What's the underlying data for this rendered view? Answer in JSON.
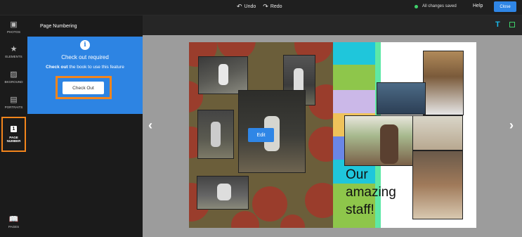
{
  "topbar": {
    "undo_label": "Undo",
    "redo_label": "Redo",
    "saved_status": "All changes saved",
    "help_label": "Help",
    "close_label": "Close"
  },
  "leftnav": {
    "items": [
      {
        "label": "PHOTOS",
        "icon": "photos-icon"
      },
      {
        "label": "ELEMENTS",
        "icon": "star-icon"
      },
      {
        "label": "BKGROUND",
        "icon": "background-icon"
      },
      {
        "label": "PORTRAITS",
        "icon": "portraits-icon"
      }
    ],
    "active": {
      "number": "1",
      "label_line1": "PAGE",
      "label_line2": "NUMBER"
    },
    "pages_label": "PAGES"
  },
  "panel": {
    "title": "Page Numbering",
    "card_title": "Check out required",
    "card_msg_bold": "Check out",
    "card_msg_rest": " the book to use this feature",
    "checkout_label": "Check Out"
  },
  "canvas": {
    "edit_label": "Edit",
    "staff_text_lines": [
      "Our",
      "amazing",
      "staff!"
    ]
  },
  "colors": {
    "accent": "#2f86e6",
    "highlight": "#f3851c",
    "saved_dot": "#3fd16b"
  }
}
